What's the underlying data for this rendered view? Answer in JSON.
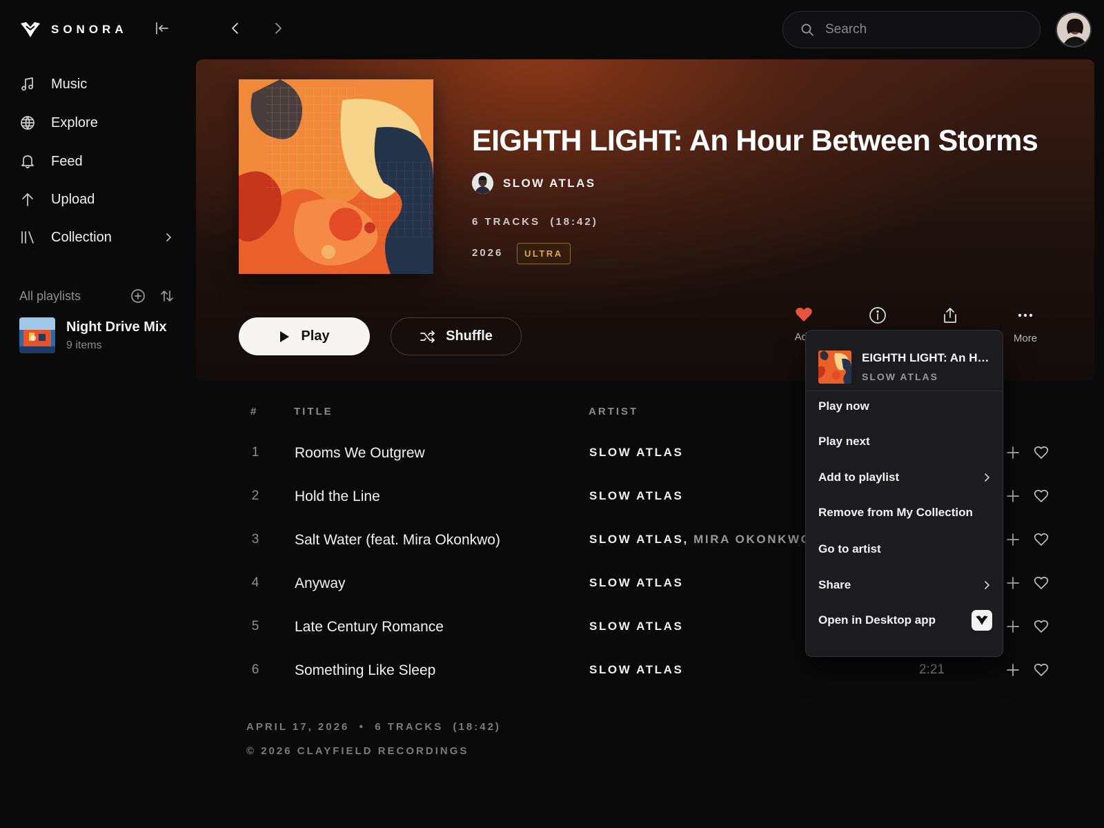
{
  "brand": {
    "name": "SONORA"
  },
  "search": {
    "placeholder": "Search"
  },
  "sidebar": {
    "items": [
      {
        "label": "Music",
        "icon": "music-note-icon"
      },
      {
        "label": "Explore",
        "icon": "globe-icon"
      },
      {
        "label": "Feed",
        "icon": "bell-icon"
      },
      {
        "label": "Upload",
        "icon": "arrow-up-icon"
      },
      {
        "label": "Collection",
        "icon": "library-icon"
      }
    ],
    "playlists_header": "All playlists",
    "playlists": [
      {
        "name": "Night Drive Mix",
        "count": "9 items"
      }
    ]
  },
  "album": {
    "title": "EIGHTH LIGHT: An Hour Between Storms",
    "artist": "SLOW ATLAS",
    "tracks_meta": "6 TRACKS  (18:42)",
    "year": "2026",
    "badge": "ULTRA",
    "play_label": "Play",
    "shuffle_label": "Shuffle"
  },
  "actions": {
    "add_label": "Add",
    "more_label": "More"
  },
  "table": {
    "headers": {
      "num": "#",
      "title": "TITLE",
      "artist": "ARTIST"
    },
    "rows": [
      {
        "num": "1",
        "title": "Rooms We Outgrew",
        "artist": "SLOW ATLAS",
        "feat": "",
        "duration": ""
      },
      {
        "num": "2",
        "title": "Hold the Line",
        "artist": "SLOW ATLAS",
        "feat": "",
        "duration": ""
      },
      {
        "num": "3",
        "title": "Salt Water (feat. Mira Okonkwo)",
        "artist": "SLOW ATLAS,",
        "feat": " MIRA OKONKWO",
        "duration": ""
      },
      {
        "num": "4",
        "title": "Anyway",
        "artist": "SLOW ATLAS",
        "feat": "",
        "duration": ""
      },
      {
        "num": "5",
        "title": "Late Century Romance",
        "artist": "SLOW ATLAS",
        "feat": "",
        "duration": ""
      },
      {
        "num": "6",
        "title": "Something Like Sleep",
        "artist": "SLOW ATLAS",
        "feat": "",
        "duration": "2:21"
      }
    ]
  },
  "footer": {
    "line1": "APRIL 17, 2026  •  6 TRACKS  (18:42)",
    "line2": "© 2026 CLAYFIELD RECORDINGS"
  },
  "menu": {
    "title": "EIGHTH LIGHT: An Hour Between Storms",
    "artist": "SLOW ATLAS",
    "items": [
      {
        "label": "Play now"
      },
      {
        "label": "Play next"
      },
      {
        "label": "Add to playlist"
      },
      {
        "label": "Remove from My Collection"
      },
      {
        "label": "Go to artist"
      },
      {
        "label": "Share"
      },
      {
        "label": "Open in Desktop app"
      }
    ]
  },
  "colors": {
    "accent_heart": "#e8553f",
    "badge": "#e0a83c",
    "background": "#0a0a0b"
  }
}
